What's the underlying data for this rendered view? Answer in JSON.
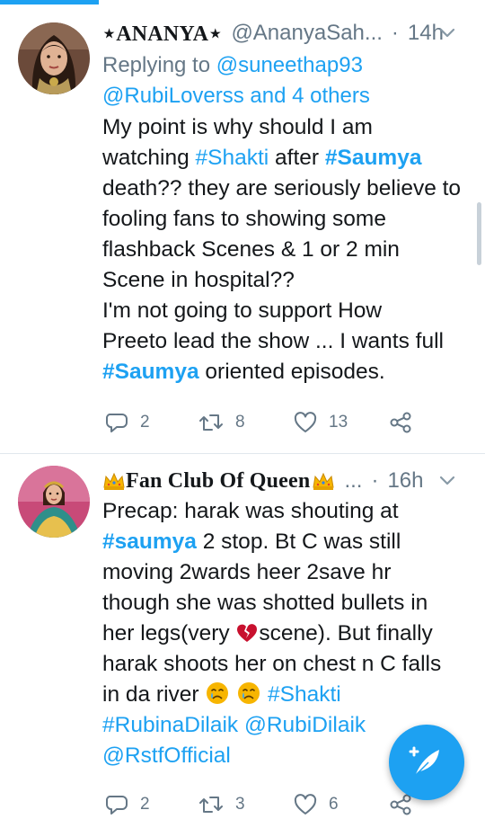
{
  "tweets": [
    {
      "display_name": "⋆ANANYA⋆",
      "handle": "@AnanyaSah...",
      "separator": "·",
      "time": "14h",
      "replying_label": "Replying to",
      "replying_user": "@suneethap93",
      "replying_line2": "@RubiLoverss and 4 others",
      "lines": [
        [
          "My point is why should I am"
        ],
        [
          "watching ",
          "#Shakti",
          " after ",
          "#Saumya"
        ],
        [
          "death?? they are seriously believe to"
        ],
        [
          "fooling fans to showing some"
        ],
        [
          "flashback Scenes & 1 or 2 min"
        ],
        [
          "Scene in hospital??"
        ],
        [
          "I'm not going to support How"
        ],
        [
          "Preeto lead the show ... I wants full"
        ],
        [
          "#Saumya",
          " oriented episodes."
        ]
      ],
      "replies": "2",
      "retweets": "8",
      "likes": "13"
    },
    {
      "display_name": "Fan Club Of Queen",
      "handle": "...",
      "separator": "·",
      "time": "16h",
      "lines": [
        [
          "Precap: harak was shouting at"
        ],
        [
          "#saumya",
          " 2 stop. Bt C was still"
        ],
        [
          "moving 2wards heer 2save hr"
        ],
        [
          "though she was shotted bullets in"
        ],
        [
          "her legs(very ",
          "scene). But finally"
        ],
        [
          "harak shoots her on chest n C falls"
        ],
        [
          "in da river ",
          "#Shakti"
        ],
        [
          "#RubinaDilaik",
          " ",
          "@RubiDilaik"
        ],
        [
          "@RstfOfficial"
        ]
      ],
      "replies": "2",
      "retweets": "3",
      "likes": "6"
    }
  ],
  "icons": {
    "reply": "reply-icon",
    "retweet": "retweet-icon",
    "like": "heart-icon",
    "share": "share-icon",
    "more": "chevron-down-icon",
    "compose": "compose-tweet-icon",
    "broken_heart": "broken-heart-emoji",
    "crying_face": "crying-face-emoji",
    "crown": "crown-emoji"
  },
  "colors": {
    "accent": "#1da1f2",
    "text": "#14171a",
    "secondary": "#657786",
    "divider": "#e1e8ed",
    "broken_heart": "#c8102e",
    "emoji_face": "#f7b500"
  }
}
